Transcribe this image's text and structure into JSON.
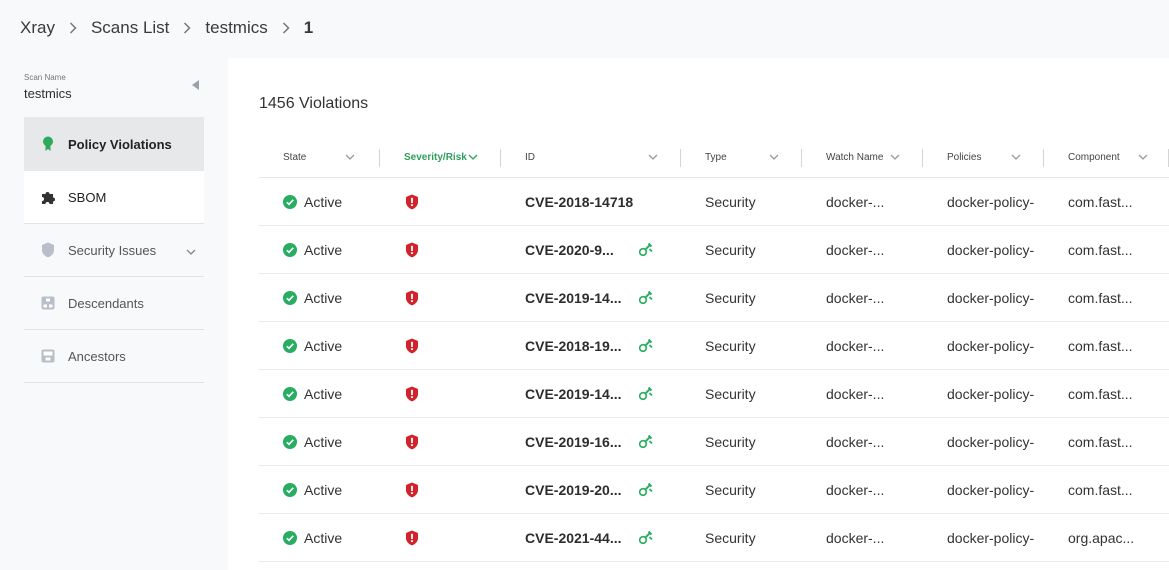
{
  "breadcrumb": [
    {
      "label": "Xray"
    },
    {
      "label": "Scans List"
    },
    {
      "label": "testmics"
    },
    {
      "label": "1"
    }
  ],
  "sidebar": {
    "scan_name_label": "Scan Name",
    "scan_name_value": "testmics",
    "items": [
      {
        "label": "Policy Violations",
        "icon": "ribbon-icon"
      },
      {
        "label": "SBOM",
        "icon": "puzzle-icon"
      },
      {
        "label": "Security Issues",
        "icon": "shield-icon"
      },
      {
        "label": "Descendants",
        "icon": "descendants-icon"
      },
      {
        "label": "Ancestors",
        "icon": "ancestors-icon"
      }
    ]
  },
  "main": {
    "title": "1456 Violations",
    "columns": [
      "State",
      "Severity/Risk",
      "ID",
      "Type",
      "Watch Name",
      "Policies",
      "Component"
    ],
    "sorted_column": "Severity/Risk",
    "rows": [
      {
        "state": "Active",
        "id": "CVE-2018-14718",
        "fixable": false,
        "type": "Security",
        "watch": "docker-...",
        "policy": "docker-policy-",
        "component": "com.fast..."
      },
      {
        "state": "Active",
        "id": "CVE-2020-9...",
        "fixable": true,
        "type": "Security",
        "watch": "docker-...",
        "policy": "docker-policy-",
        "component": "com.fast..."
      },
      {
        "state": "Active",
        "id": "CVE-2019-14...",
        "fixable": true,
        "type": "Security",
        "watch": "docker-...",
        "policy": "docker-policy-",
        "component": "com.fast..."
      },
      {
        "state": "Active",
        "id": "CVE-2018-19...",
        "fixable": true,
        "type": "Security",
        "watch": "docker-...",
        "policy": "docker-policy-",
        "component": "com.fast..."
      },
      {
        "state": "Active",
        "id": "CVE-2019-14...",
        "fixable": true,
        "type": "Security",
        "watch": "docker-...",
        "policy": "docker-policy-",
        "component": "com.fast..."
      },
      {
        "state": "Active",
        "id": "CVE-2019-16...",
        "fixable": true,
        "type": "Security",
        "watch": "docker-...",
        "policy": "docker-policy-",
        "component": "com.fast..."
      },
      {
        "state": "Active",
        "id": "CVE-2019-20...",
        "fixable": true,
        "type": "Security",
        "watch": "docker-...",
        "policy": "docker-policy-",
        "component": "com.fast..."
      },
      {
        "state": "Active",
        "id": "CVE-2021-44...",
        "fixable": true,
        "type": "Security",
        "watch": "docker-...",
        "policy": "docker-policy-",
        "component": "org.apac..."
      }
    ]
  },
  "colors": {
    "accent_green": "#2e9e5b",
    "severity_red": "#d0232b",
    "active_green": "#27ae60"
  }
}
